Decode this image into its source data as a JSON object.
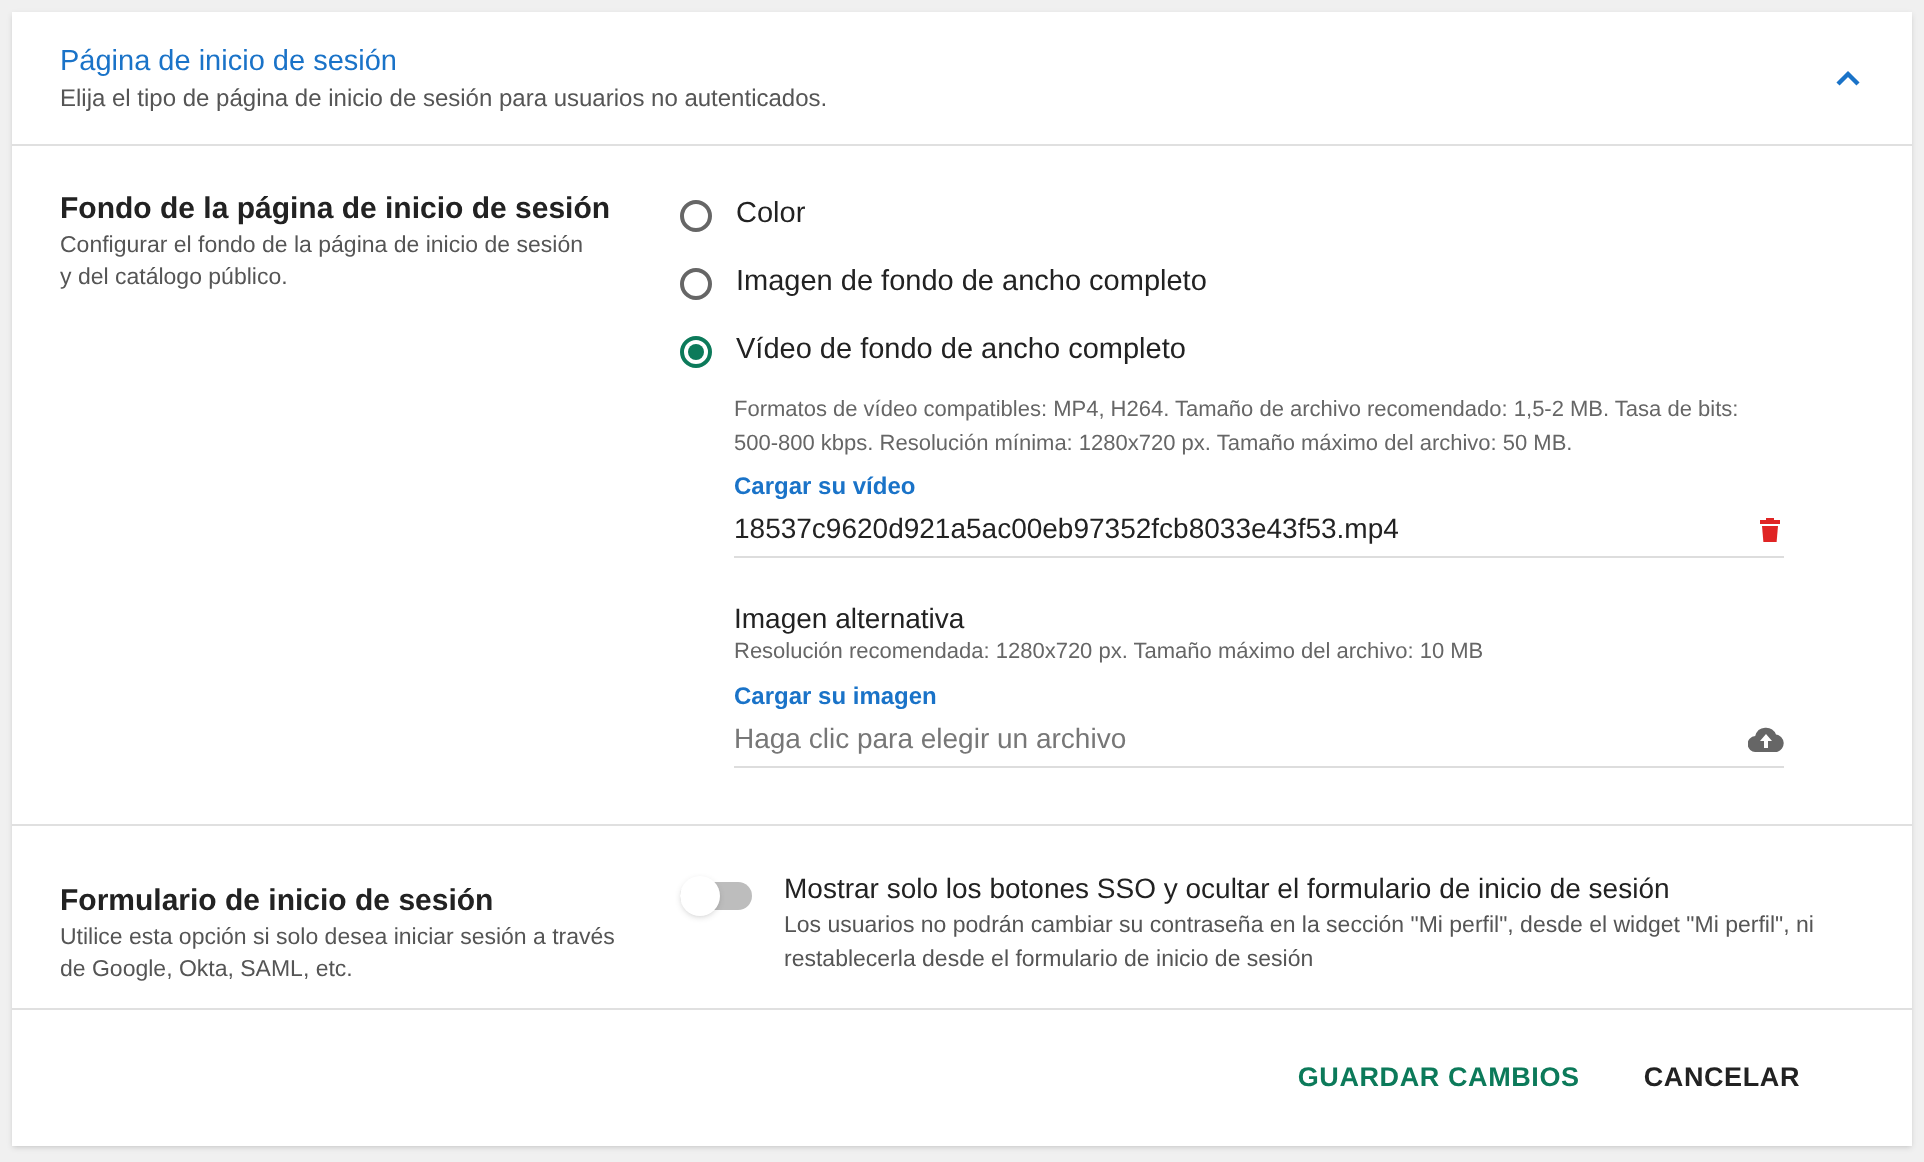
{
  "header": {
    "title": "Página de inicio de sesión",
    "subtitle": "Elija el tipo de página de inicio de sesión para usuarios no autenticados.",
    "expanded": true
  },
  "background": {
    "title": "Fondo de la página de inicio de sesión",
    "description": "Configurar el fondo de la página de inicio de sesión y del catálogo público.",
    "options": [
      {
        "label": "Color",
        "selected": false
      },
      {
        "label": "Imagen de fondo de ancho completo",
        "selected": false
      },
      {
        "label": "Vídeo de fondo de ancho completo",
        "selected": true
      }
    ],
    "video": {
      "hint": "Formatos de vídeo compatibles: MP4, H264. Tamaño de archivo recomendado: 1,5-2 MB. Tasa de bits: 500-800 kbps. Resolución mínima: 1280x720 px. Tamaño máximo del archivo: 50 MB.",
      "upload_label": "Cargar su vídeo",
      "value": "18537c9620d921a5ac00eb97352fcb8033e43f53.mp4"
    },
    "fallback": {
      "title": "Imagen alternativa",
      "hint": "Resolución recomendada: 1280x720 px. Tamaño máximo del archivo: 10 MB",
      "upload_label": "Cargar su imagen",
      "placeholder": "Haga clic para elegir un archivo"
    }
  },
  "login_form": {
    "title": "Formulario de inicio de sesión",
    "description": "Utilice esta opción si solo desea iniciar sesión a través de Google, Okta, SAML, etc.",
    "toggle_label": "Mostrar solo los botones SSO y ocultar el formulario de inicio de sesión",
    "toggle_note": "Los usuarios no podrán cambiar su contraseña en la sección \"Mi perfil\", desde el widget \"Mi perfil\", ni restablecerla desde el formulario de inicio de sesión",
    "on": false
  },
  "buttons": [
    {
      "label": "GUARDAR CAMBIOS",
      "kind": "primary"
    },
    {
      "label": "CANCELAR",
      "kind": "secondary"
    }
  ]
}
